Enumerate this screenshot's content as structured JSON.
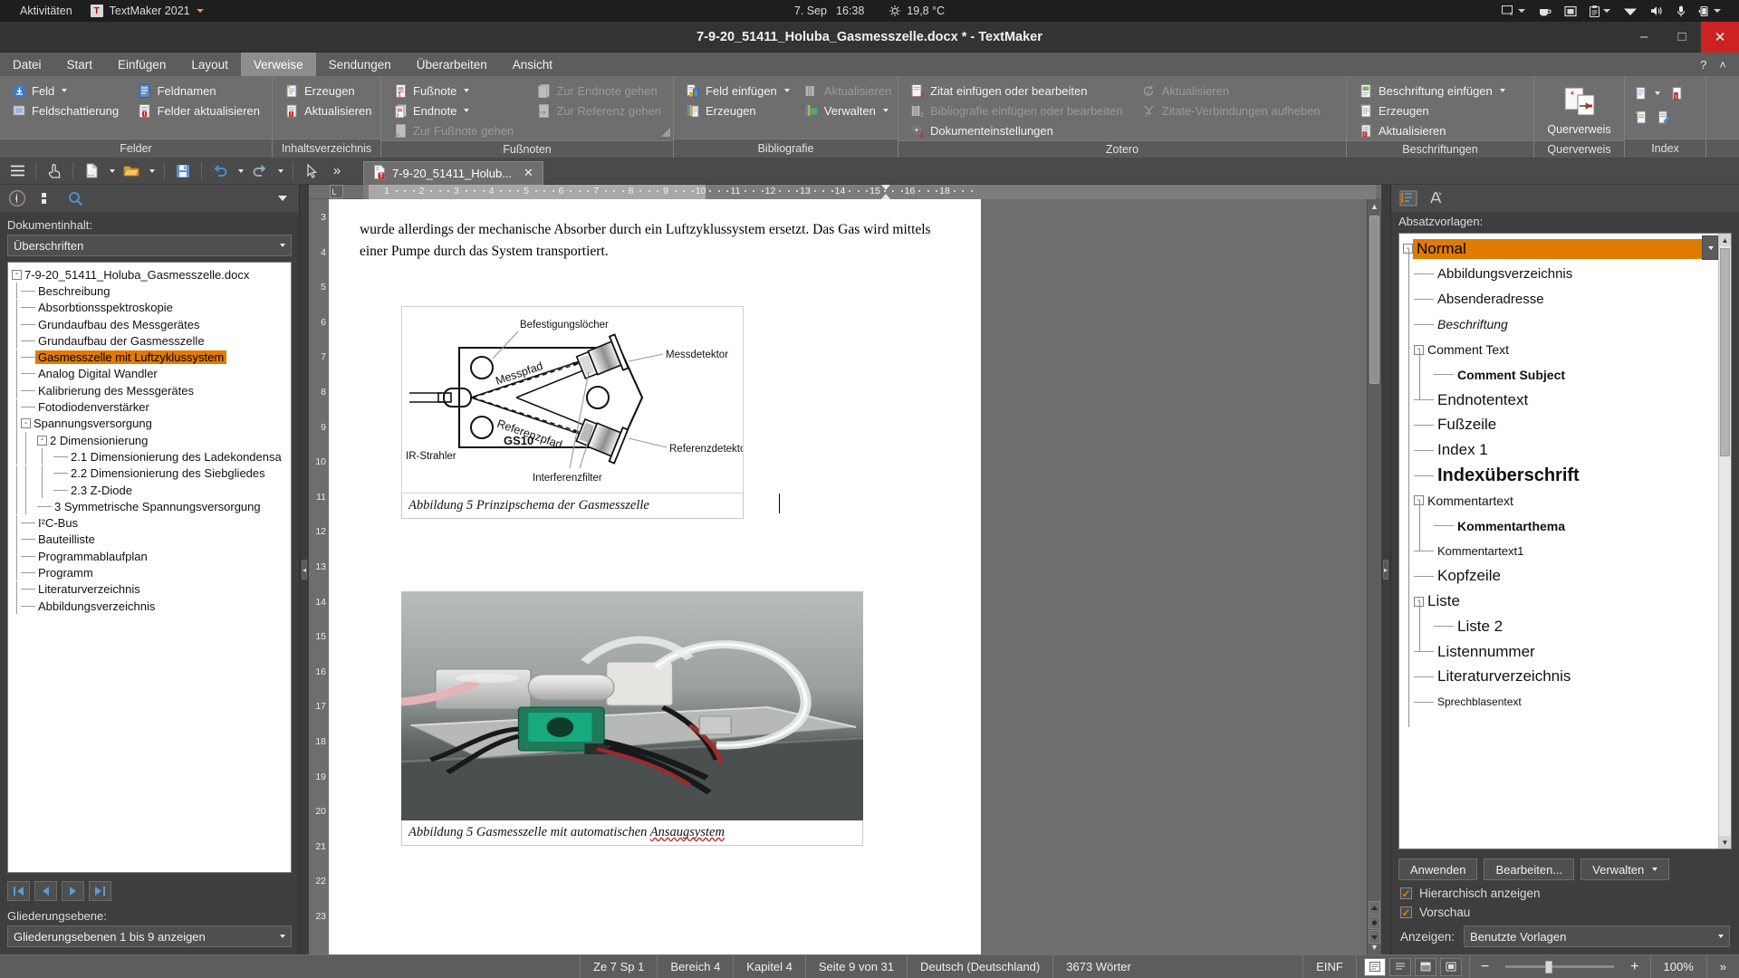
{
  "gnome": {
    "activities": "Aktivitäten",
    "app_name": "TextMaker 2021",
    "app_icon": "T",
    "date": "7. Sep",
    "time": "16:38",
    "weather_icon": "sun-icon",
    "temperature": "19,8 °C",
    "tray": [
      {
        "name": "screen-off-icon",
        "has_caret": true
      },
      {
        "name": "coffee-cup-icon",
        "has_caret": false
      },
      {
        "name": "screencast-icon",
        "has_caret": false
      },
      {
        "name": "clipboard-icon",
        "has_caret": true
      },
      {
        "name": "wifi-icon",
        "has_caret": false
      },
      {
        "name": "volume-icon",
        "has_caret": false
      },
      {
        "name": "microphone-icon",
        "has_caret": false
      },
      {
        "name": "battery-icon",
        "has_caret": true
      }
    ]
  },
  "window": {
    "title": "7-9-20_51411_Holuba_Gasmesszelle.docx * - TextMaker",
    "minimize": "–",
    "maximize": "□",
    "close": "✕"
  },
  "menubar": {
    "items": [
      "Datei",
      "Start",
      "Einfügen",
      "Layout",
      "Verweise",
      "Sendungen",
      "Überarbeiten",
      "Ansicht"
    ],
    "active": "Verweise",
    "help_icon": "?",
    "collapse_icon": "˄"
  },
  "ribbon": {
    "groups": [
      {
        "label": "Felder",
        "columns": [
          {
            "items": [
              {
                "label": "Feld",
                "icon": "field-icon",
                "caret": true,
                "disabled": false
              },
              {
                "label": "Feldschattierung",
                "icon": "field-shading-icon",
                "caret": false,
                "disabled": false
              }
            ]
          },
          {
            "items": [
              {
                "label": "Feldnamen",
                "icon": "field-names-icon",
                "caret": false,
                "disabled": false
              },
              {
                "label": "Felder aktualisieren",
                "icon": "refresh-fields-icon",
                "caret": false,
                "disabled": false
              }
            ]
          }
        ]
      },
      {
        "label": "Inhaltsverzeichnis",
        "columns": [
          {
            "items": [
              {
                "label": "Erzeugen",
                "icon": "toc-create-icon",
                "caret": false,
                "disabled": false
              },
              {
                "label": "Aktualisieren",
                "icon": "toc-update-icon",
                "caret": false,
                "disabled": false
              }
            ]
          }
        ]
      },
      {
        "label": "Fußnoten",
        "columns": [
          {
            "items": [
              {
                "label": "Fußnote",
                "icon": "footnote-icon",
                "caret": true,
                "disabled": false
              },
              {
                "label": "Endnote",
                "icon": "endnote-icon",
                "caret": true,
                "disabled": false
              },
              {
                "label": "Zur Fußnote gehen",
                "icon": "goto-footnote-icon",
                "caret": false,
                "disabled": true
              }
            ]
          },
          {
            "items": [
              {
                "label": "Zur Endnote gehen",
                "icon": "goto-endnote-icon",
                "caret": false,
                "disabled": true
              },
              {
                "label": "Zur Referenz gehen",
                "icon": "goto-reference-icon",
                "caret": false,
                "disabled": true
              }
            ]
          }
        ]
      },
      {
        "label": "Bibliografie",
        "columns": [
          {
            "items": [
              {
                "label": "Feld einfügen",
                "icon": "insert-field-icon",
                "caret": true,
                "disabled": false
              },
              {
                "label": "Erzeugen",
                "icon": "biblio-create-icon",
                "caret": false,
                "disabled": false
              }
            ]
          },
          {
            "items": [
              {
                "label": "Aktualisieren",
                "icon": "biblio-update-icon",
                "caret": false,
                "disabled": true
              },
              {
                "label": "Verwalten",
                "icon": "biblio-manage-icon",
                "caret": true,
                "disabled": false
              }
            ]
          }
        ]
      },
      {
        "label": "Zotero",
        "columns": [
          {
            "items": [
              {
                "label": "Zitat einfügen oder bearbeiten",
                "icon": "zotero-citation-icon",
                "caret": false,
                "disabled": false
              },
              {
                "label": "Bibliografie einfügen oder bearbeiten",
                "icon": "zotero-biblio-icon",
                "caret": false,
                "disabled": true
              },
              {
                "label": "Dokumenteinstellungen",
                "icon": "zotero-settings-icon",
                "caret": false,
                "disabled": false
              }
            ]
          },
          {
            "items": [
              {
                "label": "Aktualisieren",
                "icon": "zotero-refresh-icon",
                "caret": false,
                "disabled": true
              },
              {
                "label": "Zitate-Verbindungen aufheben",
                "icon": "zotero-unlink-icon",
                "caret": false,
                "disabled": true
              }
            ]
          }
        ]
      },
      {
        "label": "Beschriftungen",
        "columns": [
          {
            "items": [
              {
                "label": "Beschriftung einfügen",
                "icon": "caption-insert-icon",
                "caret": true,
                "disabled": false
              },
              {
                "label": "Erzeugen",
                "icon": "caption-create-icon",
                "caret": false,
                "disabled": false
              },
              {
                "label": "Aktualisieren",
                "icon": "caption-update-icon",
                "caret": false,
                "disabled": false
              }
            ]
          }
        ]
      },
      {
        "label": "Querverweis",
        "big_button": {
          "label": "Querverweis",
          "icon": "cross-reference-icon"
        }
      },
      {
        "label": "Index",
        "icon_grid": [
          {
            "name": "index-entry-icon",
            "caret": true
          },
          {
            "name": "index-update-icon",
            "caret": false
          },
          {
            "name": "index-create-icon",
            "caret": false
          },
          {
            "name": "index-edit-icon",
            "caret": false
          }
        ]
      }
    ]
  },
  "quickbar": {
    "buttons": [
      {
        "name": "hamburger-menu-icon",
        "glyph": "☰"
      },
      {
        "name": "touch-mode-icon",
        "glyph": "☝"
      },
      {
        "name": "new-document-icon",
        "glyph": "doc"
      },
      {
        "name": "open-folder-icon",
        "glyph": "folder"
      },
      {
        "name": "save-icon",
        "glyph": "save"
      },
      {
        "name": "undo-icon",
        "glyph": "↶"
      },
      {
        "name": "redo-icon",
        "glyph": "↷"
      },
      {
        "name": "pointer-icon",
        "glyph": "▹"
      },
      {
        "name": "overflow-icon",
        "glyph": "»"
      }
    ],
    "document_tab": {
      "label": "7-9-20_51411_Holub...",
      "close": "✕"
    }
  },
  "navigator": {
    "toolbar": [
      {
        "name": "navigator-compass-icon"
      },
      {
        "name": "navigator-list-icon"
      },
      {
        "name": "navigator-search-icon"
      },
      {
        "name": "navigator-dropdown-icon"
      }
    ],
    "label": "Dokumentinhalt:",
    "filter_value": "Überschriften",
    "tree": [
      {
        "label": "7-9-20_51411_Holuba_Gasmesszelle.docx",
        "depth": 0,
        "toggle": "-",
        "selected": false
      },
      {
        "label": "Beschreibung",
        "depth": 1,
        "toggle": "",
        "selected": false
      },
      {
        "label": "Absorbtionsspektroskopie",
        "depth": 1,
        "toggle": "",
        "selected": false
      },
      {
        "label": "Grundaufbau des Messgerätes",
        "depth": 1,
        "toggle": "",
        "selected": false
      },
      {
        "label": "Grundaufbau der Gasmesszelle",
        "depth": 1,
        "toggle": "",
        "selected": false
      },
      {
        "label": "Gasmesszelle mit Luftzyklussystem",
        "depth": 1,
        "toggle": "",
        "selected": true
      },
      {
        "label": "Analog Digital Wandler",
        "depth": 1,
        "toggle": "",
        "selected": false
      },
      {
        "label": "Kalibrierung des Messgerätes",
        "depth": 1,
        "toggle": "",
        "selected": false
      },
      {
        "label": "Fotodiodenverstärker",
        "depth": 1,
        "toggle": "",
        "selected": false
      },
      {
        "label": "Spannungsversorgung",
        "depth": 1,
        "toggle": "-",
        "selected": false
      },
      {
        "label": "2 Dimensionierung",
        "depth": 2,
        "toggle": "-",
        "selected": false
      },
      {
        "label": "2.1 Dimensionierung des Ladekondensa",
        "depth": 3,
        "toggle": "",
        "selected": false
      },
      {
        "label": "2.2 Dimensionierung des Siebgliedes",
        "depth": 3,
        "toggle": "",
        "selected": false
      },
      {
        "label": "2.3 Z-Diode",
        "depth": 3,
        "toggle": "",
        "selected": false
      },
      {
        "label": "3 Symmetrische Spannungsversorgung",
        "depth": 2,
        "toggle": "",
        "selected": false
      },
      {
        "label": "I²C-Bus",
        "depth": 1,
        "toggle": "",
        "selected": false
      },
      {
        "label": "Bauteilliste",
        "depth": 1,
        "toggle": "",
        "selected": false
      },
      {
        "label": "Programmablaufplan",
        "depth": 1,
        "toggle": "",
        "selected": false
      },
      {
        "label": "Programm",
        "depth": 1,
        "toggle": "",
        "selected": false
      },
      {
        "label": "Literaturverzeichnis",
        "depth": 1,
        "toggle": "",
        "selected": false
      },
      {
        "label": "Abbildungsverzeichnis",
        "depth": 1,
        "toggle": "",
        "selected": false
      }
    ],
    "pager": [
      {
        "name": "first-page-button",
        "glyph": "|◀"
      },
      {
        "name": "prev-page-button",
        "glyph": "◀"
      },
      {
        "name": "next-page-button",
        "glyph": "▶"
      },
      {
        "name": "last-page-button",
        "glyph": "▶|"
      }
    ],
    "outline_label": "Gliederungsebene:",
    "outline_value": "Gliederungsebenen 1 bis 9 anzeigen"
  },
  "ruler": {
    "numbers": [
      "1",
      "2",
      "3",
      "4",
      "5",
      "6",
      "7",
      "8",
      "9",
      "10",
      "11",
      "12",
      "13",
      "14",
      "15",
      "16",
      "18"
    ],
    "tab_marker": "L",
    "vertical_numbers": [
      "3",
      "4",
      "5",
      "6",
      "7",
      "8",
      "9",
      "10",
      "11",
      "12",
      "13",
      "14",
      "15",
      "16",
      "17",
      "18",
      "19",
      "20",
      "21",
      "22",
      "23"
    ]
  },
  "document": {
    "paragraph": "wurde allerdings der mechanische Absorber durch ein Luftzyklussystem ersetzt. Das Gas wird mittels einer Pumpe durch das System transportiert.",
    "figure1": {
      "name": "gasmesszelle-schema-figure",
      "labels": {
        "befestigungsloecher": "Befestigungslöcher",
        "messpfad": "Messpfad",
        "messdetektor": "Messdetektor",
        "ir_strahler": "IR-Strahler",
        "referenzpfad": "Referenzpfad",
        "referenzdetektor": "Referenzdetektor",
        "interferenzfilter": "Interferenzfilter",
        "device_name": "GS10"
      },
      "caption": "Abbildung 5 Prinzipschema der Gasmesszelle"
    },
    "figure2": {
      "name": "gasmesszelle-photo-figure",
      "caption_prefix": "Abbildung 5 Gasmesszelle mit automatischen ",
      "caption_spellerror": "Ansaugsystem"
    }
  },
  "stylepanel": {
    "toolbar": [
      {
        "name": "style-paragraph-icon"
      },
      {
        "name": "style-character-icon"
      }
    ],
    "label": "Absatzvorlagen:",
    "tree": [
      {
        "label": "Normal",
        "depth": 0,
        "toggle": "-",
        "selected": true,
        "style": "normal",
        "size": 17
      },
      {
        "label": "Abbildungsverzeichnis",
        "depth": 1,
        "toggle": "",
        "selected": false,
        "style": "normal",
        "size": 15
      },
      {
        "label": "Absenderadresse",
        "depth": 1,
        "toggle": "",
        "selected": false,
        "style": "normal",
        "size": 15
      },
      {
        "label": "Beschriftung",
        "depth": 1,
        "toggle": "",
        "selected": false,
        "style": "italic",
        "size": 14
      },
      {
        "label": "Comment Text",
        "depth": 1,
        "toggle": "-",
        "selected": false,
        "style": "normal",
        "size": 14
      },
      {
        "label": "Comment Subject",
        "depth": 2,
        "toggle": "",
        "selected": false,
        "style": "bold",
        "size": 14
      },
      {
        "label": "Endnotentext",
        "depth": 1,
        "toggle": "",
        "selected": false,
        "style": "normal",
        "size": 17
      },
      {
        "label": "Fußzeile",
        "depth": 1,
        "toggle": "",
        "selected": false,
        "style": "normal",
        "size": 17
      },
      {
        "label": "Index 1",
        "depth": 1,
        "toggle": "",
        "selected": false,
        "style": "normal",
        "size": 17
      },
      {
        "label": "Indexüberschrift",
        "depth": 1,
        "toggle": "",
        "selected": false,
        "style": "bold",
        "size": 20
      },
      {
        "label": "Kommentartext",
        "depth": 1,
        "toggle": "-",
        "selected": false,
        "style": "normal",
        "size": 14
      },
      {
        "label": "Kommentarthema",
        "depth": 2,
        "toggle": "",
        "selected": false,
        "style": "bold",
        "size": 14
      },
      {
        "label": "Kommentartext1",
        "depth": 1,
        "toggle": "",
        "selected": false,
        "style": "normal",
        "size": 13
      },
      {
        "label": "Kopfzeile",
        "depth": 1,
        "toggle": "",
        "selected": false,
        "style": "normal",
        "size": 17
      },
      {
        "label": "Liste",
        "depth": 1,
        "toggle": "-",
        "selected": false,
        "style": "normal",
        "size": 17
      },
      {
        "label": "Liste 2",
        "depth": 2,
        "toggle": "",
        "selected": false,
        "style": "normal",
        "size": 17
      },
      {
        "label": "Listennummer",
        "depth": 1,
        "toggle": "",
        "selected": false,
        "style": "normal",
        "size": 17
      },
      {
        "label": "Literaturverzeichnis",
        "depth": 1,
        "toggle": "",
        "selected": false,
        "style": "normal",
        "size": 17
      },
      {
        "label": "Sprechblasentext",
        "depth": 1,
        "toggle": "",
        "selected": false,
        "style": "normal",
        "size": 12
      }
    ],
    "buttons": {
      "apply": "Anwenden",
      "edit": "Bearbeiten...",
      "manage": "Verwalten"
    },
    "checkboxes": [
      {
        "label": "Hierarchisch anzeigen",
        "checked": true
      },
      {
        "label": "Vorschau",
        "checked": true
      }
    ],
    "show_label": "Anzeigen:",
    "show_value": "Benutzte Vorlagen"
  },
  "statusbar": {
    "line_col": "Ze 7 Sp 1",
    "section": "Bereich 4",
    "chapter": "Kapitel 4",
    "page": "Seite 9 von 31",
    "language": "Deutsch (Deutschland)",
    "words": "3673 Wörter",
    "insert_mode": "EINF",
    "zoom": "100%",
    "zoom_out": "−",
    "zoom_in": "+",
    "view_buttons": [
      {
        "name": "view-print-layout-button",
        "active": true
      },
      {
        "name": "view-normal-button",
        "active": false
      },
      {
        "name": "view-outline-button",
        "active": false
      },
      {
        "name": "view-fullscreen-button",
        "active": false
      }
    ],
    "overflow": "»"
  }
}
